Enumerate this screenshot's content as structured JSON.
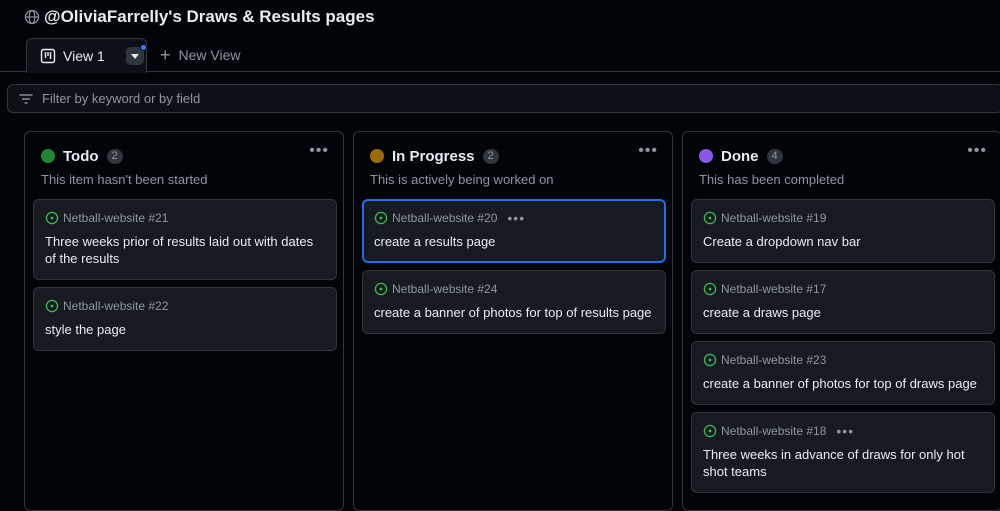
{
  "project": {
    "title": "@OliviaFarrelly's Draws & Results pages",
    "icon": "globe-icon"
  },
  "tabs": {
    "view_label": "View 1",
    "view_icon": "board-icon",
    "new_view_label": "New View"
  },
  "filter": {
    "placeholder": "Filter by keyword or by field"
  },
  "colors": {
    "todo": "#238636",
    "in_progress": "#9e6a03",
    "done": "#8957e5",
    "open_issue": "#3fb950",
    "selected_border": "#1f6feb"
  },
  "columns": [
    {
      "name": "Todo",
      "count": "2",
      "description": "This item hasn't been started",
      "cards": [
        {
          "ref": "Netball-website #21",
          "title": "Three weeks prior of results laid out with dates of the results"
        },
        {
          "ref": "Netball-website #22",
          "title": "style the page"
        }
      ]
    },
    {
      "name": "In Progress",
      "count": "2",
      "description": "This is actively being worked on",
      "cards": [
        {
          "ref": "Netball-website #20",
          "title": "create a results page"
        },
        {
          "ref": "Netball-website #24",
          "title": "create a banner of photos for top of results page"
        }
      ]
    },
    {
      "name": "Done",
      "count": "4",
      "description": "This has been completed",
      "cards": [
        {
          "ref": "Netball-website #19",
          "title": "Create a dropdown nav bar"
        },
        {
          "ref": "Netball-website #17",
          "title": "create a draws page"
        },
        {
          "ref": "Netball-website #23",
          "title": "create a banner of photos for top of draws page"
        },
        {
          "ref": "Netball-website #18",
          "title": "Three weeks in advance of draws for only hot shot teams"
        }
      ]
    }
  ]
}
